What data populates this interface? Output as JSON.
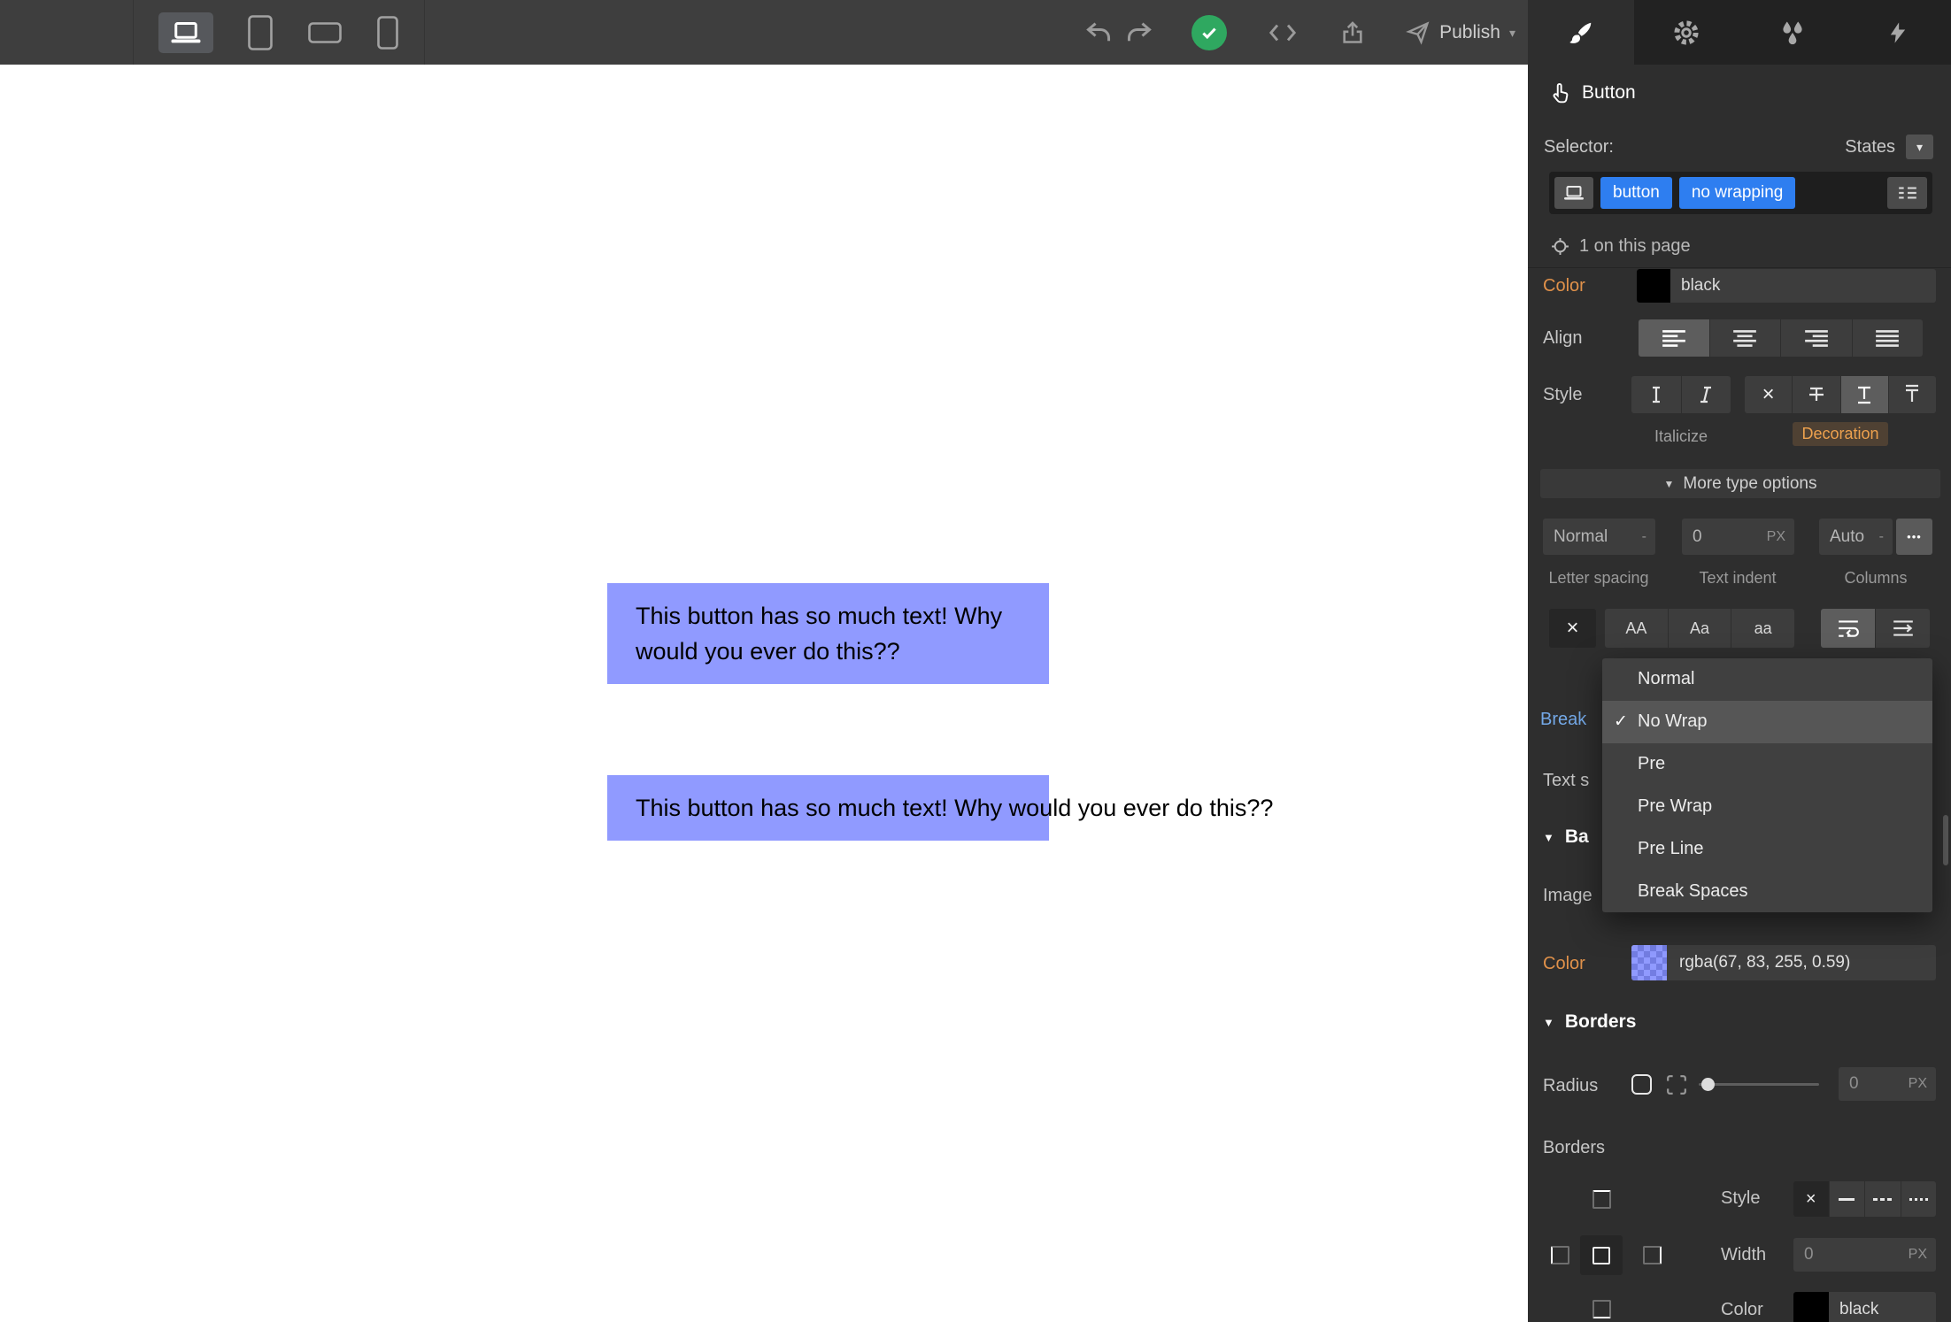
{
  "icons": {
    "chevron_down": "▾",
    "section_arrow": "▼",
    "check": "✓",
    "close": "×",
    "dots": "•••"
  },
  "topbar": {
    "publish_label": "Publish"
  },
  "canvas": {
    "button_wrapped_line1": "This button has so much text! Why",
    "button_wrapped_line2": "would you ever do this??",
    "button_nowrap_text": "This button has so much text! Why would you ever do this??",
    "button_color": "rgba(67, 83, 255, 0.59)"
  },
  "panel": {
    "element_label": "Button",
    "selector_label": "Selector:",
    "states_label": "States",
    "selector_tags": [
      "button",
      "no wrapping"
    ],
    "on_page_label": "1 on this page",
    "typography": {
      "color_label": "Color",
      "color_value": "black",
      "align_label": "Align",
      "style_label": "Style",
      "italicize_label": "Italicize",
      "decoration_label": "Decoration",
      "more_type_options_label": "More type options",
      "letter_spacing_label": "Letter spacing",
      "letter_spacing_value": "Normal",
      "letter_spacing_dash": "-",
      "text_indent_label": "Text indent",
      "text_indent_value": "0",
      "text_indent_unit": "PX",
      "columns_label": "Columns",
      "columns_value": "Auto",
      "columns_dash": "-",
      "caps_options": [
        "AA",
        "Aa",
        "aa"
      ],
      "breaking_label_fragment": "Break",
      "text_shadow_label_fragment": "Text s"
    },
    "white_space_dropdown": {
      "items": [
        "Normal",
        "No Wrap",
        "Pre",
        "Pre Wrap",
        "Pre Line",
        "Break Spaces"
      ],
      "selected": "No Wrap"
    },
    "background": {
      "section_label_fragment": "Ba",
      "image_label": "Image",
      "color_label": "Color",
      "color_value": "rgba(67, 83, 255, 0.59)"
    },
    "borders": {
      "section_label": "Borders",
      "radius_label": "Radius",
      "radius_value": "0",
      "radius_unit": "PX",
      "borders_label": "Borders",
      "style_label": "Style",
      "width_label": "Width",
      "width_value": "0",
      "width_unit": "PX",
      "color_label": "Color",
      "color_value": "black"
    }
  }
}
